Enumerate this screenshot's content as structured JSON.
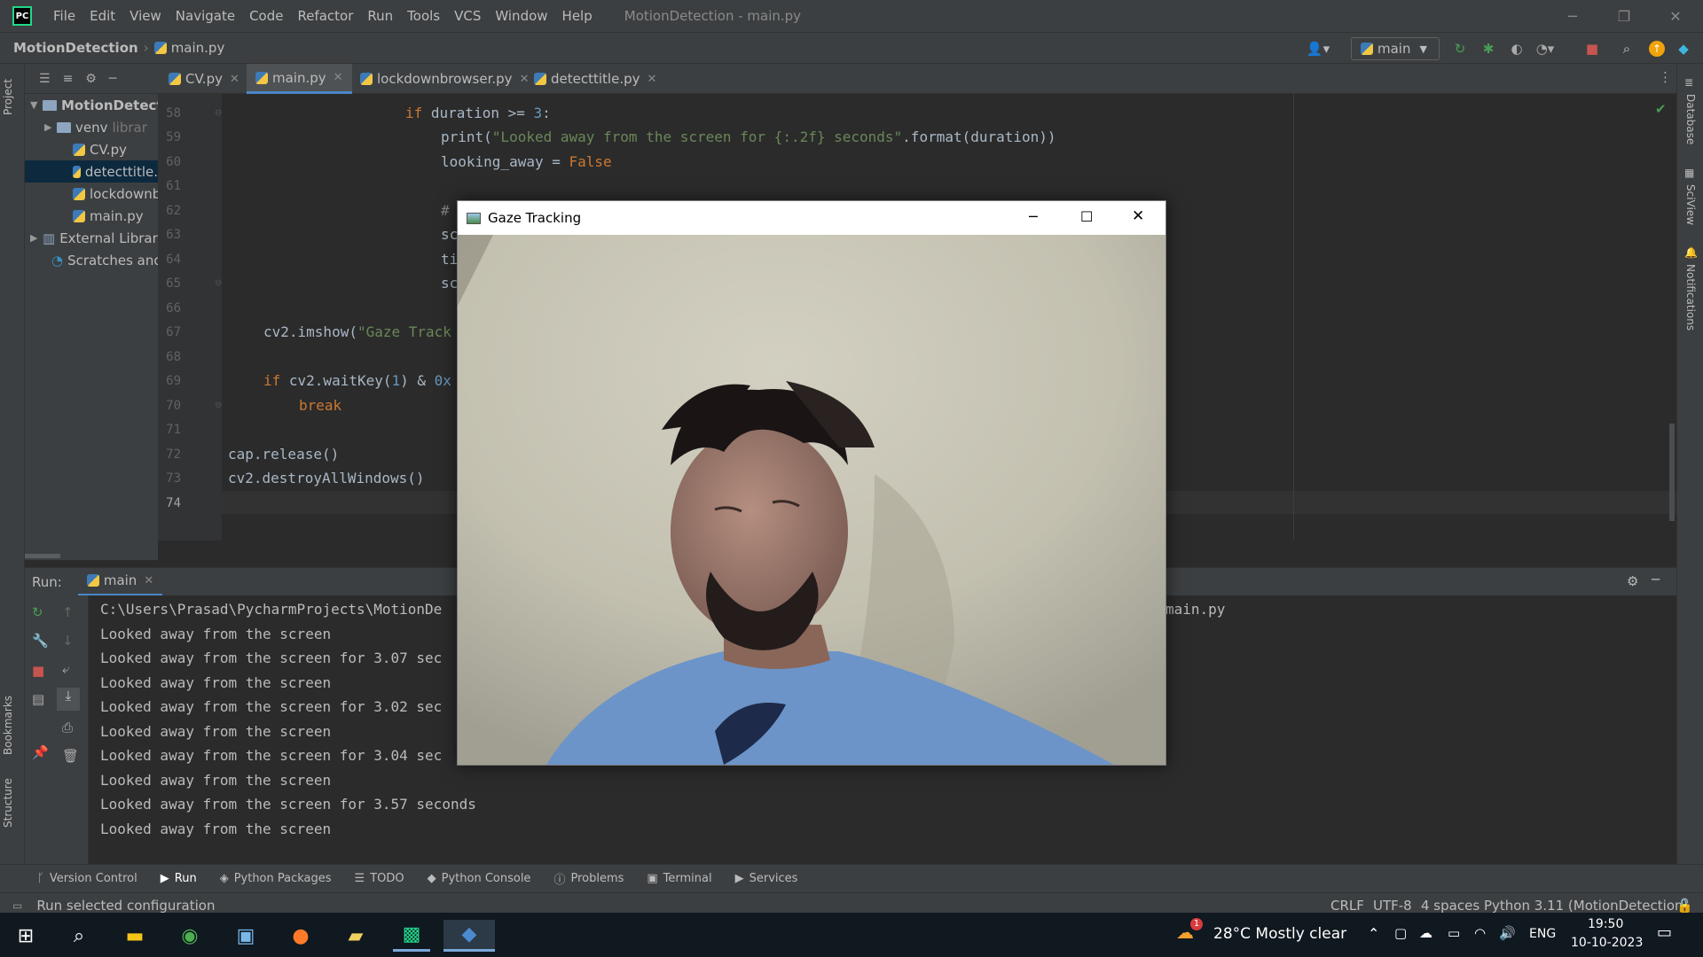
{
  "menu": {
    "items": [
      "File",
      "Edit",
      "View",
      "Navigate",
      "Code",
      "Refactor",
      "Run",
      "Tools",
      "VCS",
      "Window",
      "Help"
    ],
    "window_title": "MotionDetection - main.py"
  },
  "navbar": {
    "project": "MotionDetection",
    "file": "main.py",
    "run_config": "main"
  },
  "left_strip": {
    "project_label": "Project",
    "bookmarks_label": "Bookmarks",
    "structure_label": "Structure"
  },
  "right_strip": {
    "database_label": "Database",
    "sciview_label": "SciView",
    "notifications_label": "Notifications"
  },
  "project_tree": {
    "root": "MotionDetect",
    "venv": "venv",
    "venv_hint": "librar",
    "files": [
      "CV.py",
      "detecttitle.",
      "lockdownb",
      "main.py"
    ],
    "external": "External Librar",
    "scratches": "Scratches and"
  },
  "tabs": [
    "CV.py",
    "main.py",
    "lockdownbrowser.py",
    "detecttitle.py"
  ],
  "editor": {
    "line_numbers": [
      "58",
      "59",
      "60",
      "61",
      "62",
      "63",
      "64",
      "65",
      "66",
      "67",
      "68",
      "69",
      "70",
      "71",
      "72",
      "73",
      "74"
    ],
    "line58_kw": "if",
    "line58_rest": " duration >= ",
    "line58_num": "3",
    "line58_end": ":",
    "line59_fn": "print(",
    "line59_str": "\"Looked away from the screen for {:.2f} seconds\"",
    "line59_end": ".format(duration))",
    "line60_a": "looking_away = ",
    "line60_kw": "False",
    "line62": "#",
    "line63": "sc",
    "line64": "ti",
    "line65": "sc",
    "line67_a": "cv2.imshow(",
    "line67_str": "\"Gaze Track",
    "line69_kw": "if",
    "line69_a": " cv2.waitKey(",
    "line69_num1": "1",
    "line69_b": ") & ",
    "line69_num2": "0x",
    "line70_kw": "break",
    "line72": "cap.release()",
    "line73": "cv2.destroyAllWindows()"
  },
  "run_panel": {
    "label": "Run:",
    "tab": "main",
    "path_left": "C:\\Users\\Prasad\\PycharmProjects\\MotionDe",
    "path_right": "main.py",
    "lines": [
      "Looked away from the screen",
      "Looked away from the screen for 3.07 sec",
      "Looked away from the screen",
      "Looked away from the screen for 3.02 sec",
      "Looked away from the screen",
      "Looked away from the screen for 3.04 sec",
      "Looked away from the screen",
      "Looked away from the screen for 3.57 seconds",
      "Looked away from the screen"
    ]
  },
  "tool_tabs": [
    "Version Control",
    "Run",
    "Python Packages",
    "TODO",
    "Python Console",
    "Problems",
    "Terminal",
    "Services"
  ],
  "statusbar": {
    "message": "Run selected configuration",
    "line_sep": "CRLF",
    "encoding": "UTF-8",
    "indent": "4 spaces",
    "interpreter": "Python 3.11 (MotionDetection)"
  },
  "gaze_window": {
    "title": "Gaze Tracking"
  },
  "taskbar": {
    "weather": "28°C  Mostly clear",
    "weather_badge": "1",
    "lang": "ENG",
    "time": "19:50",
    "date": "10-10-2023"
  },
  "colors": {
    "accent": "#4a88c7",
    "keyword": "#cc7832",
    "string": "#6a8759",
    "number": "#6897bb",
    "stop": "#c75450",
    "run_green": "#499c54"
  }
}
